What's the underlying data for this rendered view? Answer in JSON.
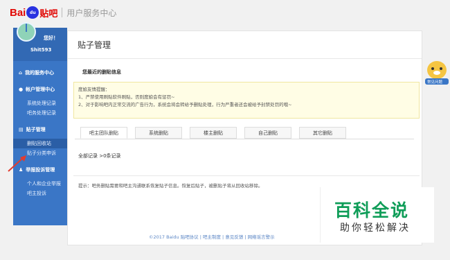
{
  "header": {
    "logo_bai": "Bai",
    "logo_du": "du",
    "logo_tieba": "贴吧",
    "subtitle": "用户服务中心"
  },
  "sidebar": {
    "greeting": "您好！",
    "username": "Shit593",
    "sections": [
      {
        "label": "我的服务中心",
        "icon": "home-icon",
        "items": []
      },
      {
        "label": "帐户管理中心",
        "icon": "user-icon",
        "items": [
          "系统处理记录",
          "吧务处理记录"
        ]
      },
      {
        "label": "贴子管理",
        "icon": "post-icon",
        "items": [
          "删贴回收站",
          "贴子分类申诉"
        ]
      },
      {
        "label": "举报投诉管理",
        "icon": "users-icon",
        "items": [
          "个人和企业举报",
          "吧主投诉"
        ]
      }
    ]
  },
  "main": {
    "title": "贴子管理",
    "section_title": "您最近的删贴信息",
    "notice": [
      "度娘友情提醒：",
      "1、严禁使用刷贴软件刷贴，否则度娘会有惩罚~",
      "2、对于影响吧内正常交流的广告行为，系统会将会转给予删贴处理，行为严重者还会被给予封禁处罚的哦~"
    ],
    "tabs": [
      "吧主团队删贴",
      "系统删贴",
      "楼主删贴",
      "自己删贴",
      "其它删贴"
    ],
    "total": "全部记录 >0条记录",
    "tip": "提示：吧务删贴需要和吧主沟通联系恢复贴子信息。恢复后贴子，被删贴子将从回收站移除。"
  },
  "footer": "©2017 Baidu 贴吧协议 | 吧主制度 | 意见反馈 | 网络谣言警示",
  "watermark": {
    "big": "百科全说",
    "small": "助你轻松解决"
  },
  "mascot": {
    "label": "常见问题"
  },
  "colors": {
    "sidebar": "#3a76c6",
    "brand_red": "#e10602",
    "brand_blue": "#2932e1",
    "watermark_green": "#0f9d58"
  }
}
